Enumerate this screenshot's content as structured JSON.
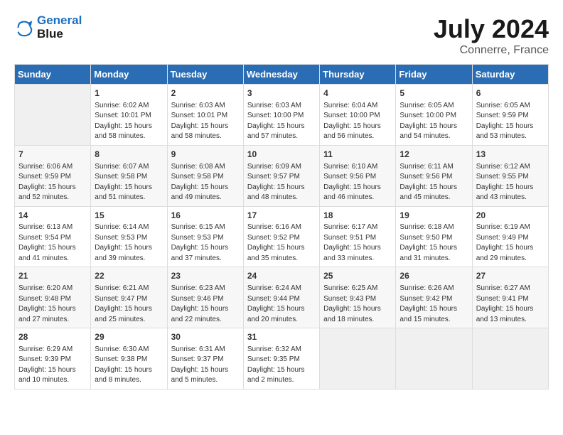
{
  "logo": {
    "line1": "General",
    "line2": "Blue"
  },
  "title": "July 2024",
  "location": "Connerre, France",
  "days_header": [
    "Sunday",
    "Monday",
    "Tuesday",
    "Wednesday",
    "Thursday",
    "Friday",
    "Saturday"
  ],
  "weeks": [
    [
      {
        "day": "",
        "info": ""
      },
      {
        "day": "1",
        "info": "Sunrise: 6:02 AM\nSunset: 10:01 PM\nDaylight: 15 hours\nand 58 minutes."
      },
      {
        "day": "2",
        "info": "Sunrise: 6:03 AM\nSunset: 10:01 PM\nDaylight: 15 hours\nand 58 minutes."
      },
      {
        "day": "3",
        "info": "Sunrise: 6:03 AM\nSunset: 10:00 PM\nDaylight: 15 hours\nand 57 minutes."
      },
      {
        "day": "4",
        "info": "Sunrise: 6:04 AM\nSunset: 10:00 PM\nDaylight: 15 hours\nand 56 minutes."
      },
      {
        "day": "5",
        "info": "Sunrise: 6:05 AM\nSunset: 10:00 PM\nDaylight: 15 hours\nand 54 minutes."
      },
      {
        "day": "6",
        "info": "Sunrise: 6:05 AM\nSunset: 9:59 PM\nDaylight: 15 hours\nand 53 minutes."
      }
    ],
    [
      {
        "day": "7",
        "info": "Sunrise: 6:06 AM\nSunset: 9:59 PM\nDaylight: 15 hours\nand 52 minutes."
      },
      {
        "day": "8",
        "info": "Sunrise: 6:07 AM\nSunset: 9:58 PM\nDaylight: 15 hours\nand 51 minutes."
      },
      {
        "day": "9",
        "info": "Sunrise: 6:08 AM\nSunset: 9:58 PM\nDaylight: 15 hours\nand 49 minutes."
      },
      {
        "day": "10",
        "info": "Sunrise: 6:09 AM\nSunset: 9:57 PM\nDaylight: 15 hours\nand 48 minutes."
      },
      {
        "day": "11",
        "info": "Sunrise: 6:10 AM\nSunset: 9:56 PM\nDaylight: 15 hours\nand 46 minutes."
      },
      {
        "day": "12",
        "info": "Sunrise: 6:11 AM\nSunset: 9:56 PM\nDaylight: 15 hours\nand 45 minutes."
      },
      {
        "day": "13",
        "info": "Sunrise: 6:12 AM\nSunset: 9:55 PM\nDaylight: 15 hours\nand 43 minutes."
      }
    ],
    [
      {
        "day": "14",
        "info": "Sunrise: 6:13 AM\nSunset: 9:54 PM\nDaylight: 15 hours\nand 41 minutes."
      },
      {
        "day": "15",
        "info": "Sunrise: 6:14 AM\nSunset: 9:53 PM\nDaylight: 15 hours\nand 39 minutes."
      },
      {
        "day": "16",
        "info": "Sunrise: 6:15 AM\nSunset: 9:53 PM\nDaylight: 15 hours\nand 37 minutes."
      },
      {
        "day": "17",
        "info": "Sunrise: 6:16 AM\nSunset: 9:52 PM\nDaylight: 15 hours\nand 35 minutes."
      },
      {
        "day": "18",
        "info": "Sunrise: 6:17 AM\nSunset: 9:51 PM\nDaylight: 15 hours\nand 33 minutes."
      },
      {
        "day": "19",
        "info": "Sunrise: 6:18 AM\nSunset: 9:50 PM\nDaylight: 15 hours\nand 31 minutes."
      },
      {
        "day": "20",
        "info": "Sunrise: 6:19 AM\nSunset: 9:49 PM\nDaylight: 15 hours\nand 29 minutes."
      }
    ],
    [
      {
        "day": "21",
        "info": "Sunrise: 6:20 AM\nSunset: 9:48 PM\nDaylight: 15 hours\nand 27 minutes."
      },
      {
        "day": "22",
        "info": "Sunrise: 6:21 AM\nSunset: 9:47 PM\nDaylight: 15 hours\nand 25 minutes."
      },
      {
        "day": "23",
        "info": "Sunrise: 6:23 AM\nSunset: 9:46 PM\nDaylight: 15 hours\nand 22 minutes."
      },
      {
        "day": "24",
        "info": "Sunrise: 6:24 AM\nSunset: 9:44 PM\nDaylight: 15 hours\nand 20 minutes."
      },
      {
        "day": "25",
        "info": "Sunrise: 6:25 AM\nSunset: 9:43 PM\nDaylight: 15 hours\nand 18 minutes."
      },
      {
        "day": "26",
        "info": "Sunrise: 6:26 AM\nSunset: 9:42 PM\nDaylight: 15 hours\nand 15 minutes."
      },
      {
        "day": "27",
        "info": "Sunrise: 6:27 AM\nSunset: 9:41 PM\nDaylight: 15 hours\nand 13 minutes."
      }
    ],
    [
      {
        "day": "28",
        "info": "Sunrise: 6:29 AM\nSunset: 9:39 PM\nDaylight: 15 hours\nand 10 minutes."
      },
      {
        "day": "29",
        "info": "Sunrise: 6:30 AM\nSunset: 9:38 PM\nDaylight: 15 hours\nand 8 minutes."
      },
      {
        "day": "30",
        "info": "Sunrise: 6:31 AM\nSunset: 9:37 PM\nDaylight: 15 hours\nand 5 minutes."
      },
      {
        "day": "31",
        "info": "Sunrise: 6:32 AM\nSunset: 9:35 PM\nDaylight: 15 hours\nand 2 minutes."
      },
      {
        "day": "",
        "info": ""
      },
      {
        "day": "",
        "info": ""
      },
      {
        "day": "",
        "info": ""
      }
    ]
  ]
}
